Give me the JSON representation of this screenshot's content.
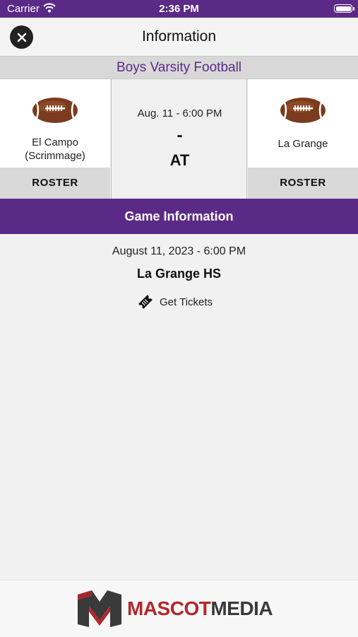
{
  "status_bar": {
    "carrier": "Carrier",
    "time": "2:36 PM"
  },
  "nav": {
    "title": "Information"
  },
  "sport": "Boys Varsity Football",
  "matchup": {
    "home": {
      "name": "El Campo\n(Scrimmage)",
      "roster_label": "ROSTER"
    },
    "away": {
      "name": "La Grange",
      "roster_label": "ROSTER"
    },
    "center": {
      "datetime": "Aug. 11 - 6:00 PM",
      "score": "-",
      "vs": "AT"
    }
  },
  "game_info": {
    "header": "Game Information",
    "date": "August 11, 2023 - 6:00 PM",
    "venue": "La Grange HS",
    "tickets_label": "Get Tickets"
  },
  "footer": {
    "brand_part1": "MASCOT",
    "brand_part2": "MEDIA"
  },
  "colors": {
    "accent": "#5b2a86",
    "brand_red": "#b3272d"
  }
}
